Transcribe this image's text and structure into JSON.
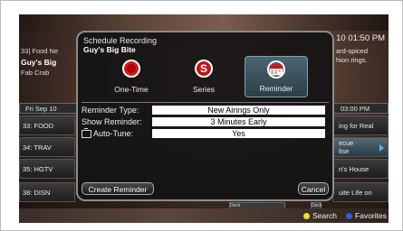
{
  "guide": {
    "time": "10 01:50 PM",
    "program_channel": "33| Food Ne",
    "program_title": "Guy's Big",
    "program_episode": "Fab Crab",
    "program_desc": "ard-spiced\nhion rings.",
    "date": "Fri Sep 10",
    "time_slot": "03:00 PM",
    "channels": [
      "33: FOOD",
      "34: TRAV",
      "35: HGTV",
      "38: DISN"
    ],
    "cells": [
      "ing for Real",
      "ecue\nlise",
      "n's House",
      "uite Life on"
    ],
    "deck_label": "Deck",
    "deck2_label": "Deck"
  },
  "legend": {
    "search_label": "Search",
    "favorites_label": "Favorites",
    "search_color": "#e9df2c",
    "favorites_color": "#2f5fd6"
  },
  "dialog": {
    "title": "Schedule Recording",
    "subtitle": "Guy's Big Bite",
    "options": [
      {
        "label": "One-Time",
        "icon": "record-icon"
      },
      {
        "label": "Series",
        "icon": "series-icon",
        "glyph": "S"
      },
      {
        "label": "Reminder",
        "icon": "calendar-icon",
        "selected": true
      }
    ],
    "fields": [
      {
        "label": "Reminder Type:",
        "value": "New Airings Only"
      },
      {
        "label": "Show Reminder:",
        "value": "3 Minutes Early"
      },
      {
        "label": "Auto-Tune:",
        "value": "Yes",
        "icon": "tv-icon"
      }
    ],
    "create_button": "Create Reminder",
    "cancel_button": "Cancel"
  }
}
